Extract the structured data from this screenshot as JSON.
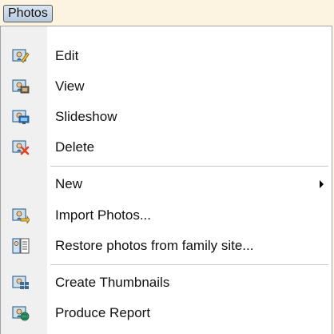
{
  "menubar": {
    "title": "Photos"
  },
  "menu": {
    "items": [
      {
        "label": "Edit",
        "icon": "photo-edit-icon"
      },
      {
        "label": "View",
        "icon": "photo-view-icon"
      },
      {
        "label": "Slideshow",
        "icon": "photo-slideshow-icon"
      },
      {
        "label": "Delete",
        "icon": "photo-delete-icon"
      },
      {
        "label": "New",
        "icon": "submenu-arrow-icon"
      },
      {
        "label": "Import Photos...",
        "icon": "photo-import-icon"
      },
      {
        "label": "Restore photos from family site...",
        "icon": "photo-restore-icon"
      },
      {
        "label": "Create Thumbnails",
        "icon": "thumbnails-icon"
      },
      {
        "label": "Produce Report",
        "icon": "report-icon"
      }
    ]
  },
  "colors": {
    "menu_title_bg": "#c8d7ea",
    "gutter": "#f0f0f0",
    "delete_x": "#e8431f"
  }
}
